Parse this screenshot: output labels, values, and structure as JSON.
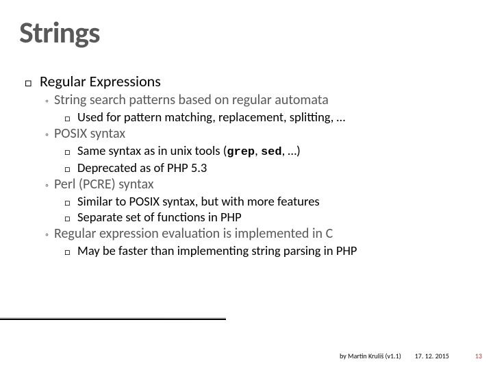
{
  "title": "Strings",
  "section": {
    "heading": "Regular Expressions",
    "bullets": [
      {
        "text": "String search patterns based on regular automata",
        "sub": [
          {
            "text": "Used for pattern matching, replacement, splitting, …"
          }
        ]
      },
      {
        "text": "POSIX syntax",
        "sub": [
          {
            "prefix": "Same syntax as in unix tools (",
            "code1": "grep",
            "mid": ", ",
            "code2": "sed",
            "suffix": ", …)"
          },
          {
            "text": "Deprecated as of PHP 5.3"
          }
        ]
      },
      {
        "text": "Perl (PCRE) syntax",
        "sub": [
          {
            "text": "Similar to POSIX syntax, but with more features"
          },
          {
            "text": "Separate set of functions in PHP"
          }
        ]
      },
      {
        "text": "Regular expression evaluation is implemented in C",
        "sub": [
          {
            "text": "May be faster than implementing string parsing in PHP"
          }
        ]
      }
    ]
  },
  "footer": {
    "author": "by Martin Kruliš (v1.1)",
    "date": "17. 12. 2015",
    "page": "13"
  }
}
